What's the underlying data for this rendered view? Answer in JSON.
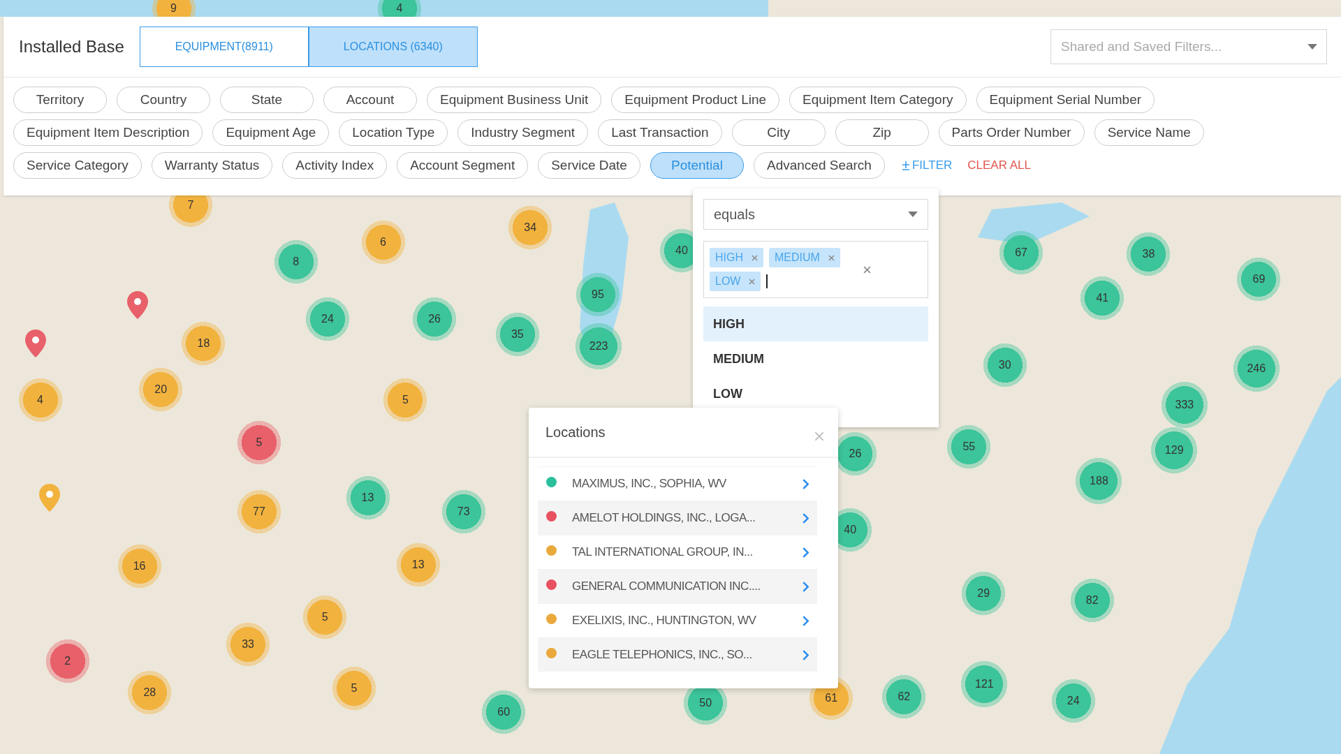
{
  "header": {
    "title": "Installed Base",
    "tabs": [
      {
        "label": "EQUIPMENT(8911)",
        "selected": false
      },
      {
        "label": "LOCATIONS (6340)",
        "selected": true
      }
    ],
    "saved_filters": {
      "placeholder": "Shared and Saved Filters..."
    }
  },
  "filters": [
    {
      "label": "Territory",
      "selected": false
    },
    {
      "label": "Country",
      "selected": false
    },
    {
      "label": "State",
      "selected": false
    },
    {
      "label": "Account",
      "selected": false
    },
    {
      "label": "Equipment Business Unit",
      "selected": false
    },
    {
      "label": "Equipment Product Line",
      "selected": false
    },
    {
      "label": "Equipment Item Category",
      "selected": false
    },
    {
      "label": "Equipment Serial Number",
      "selected": false
    },
    {
      "label": "Equipment Item Description",
      "selected": false
    },
    {
      "label": "Equipment Age",
      "selected": false
    },
    {
      "label": "Location Type",
      "selected": false
    },
    {
      "label": "Industry Segment",
      "selected": false
    },
    {
      "label": "Last Transaction",
      "selected": false
    },
    {
      "label": "City",
      "selected": false
    },
    {
      "label": "Zip",
      "selected": false
    },
    {
      "label": "Parts Order Number",
      "selected": false
    },
    {
      "label": "Service Name",
      "selected": false
    },
    {
      "label": "Service Category",
      "selected": false
    },
    {
      "label": "Warranty Status",
      "selected": false
    },
    {
      "label": "Activity Index",
      "selected": false
    },
    {
      "label": "Account Segment",
      "selected": false
    },
    {
      "label": "Service Date",
      "selected": false
    },
    {
      "label": "Potential",
      "selected": true
    },
    {
      "label": "Advanced Search",
      "selected": false
    }
  ],
  "add_filter": "FILTER",
  "clear_all": "CLEAR ALL",
  "filter_popover": {
    "operator": "equals",
    "tags": [
      "HIGH",
      "MEDIUM",
      "LOW"
    ],
    "options": [
      {
        "label": "HIGH",
        "selected": true
      },
      {
        "label": "MEDIUM",
        "selected": false
      },
      {
        "label": "LOW",
        "selected": false
      }
    ]
  },
  "map": {
    "clusters": [
      {
        "count": "9",
        "color": "#f2b23e"
      },
      {
        "count": "4",
        "color": "#3cc49a"
      },
      {
        "count": "7",
        "color": "#f2b23e"
      },
      {
        "count": "6",
        "color": "#f2b23e"
      },
      {
        "count": "34",
        "color": "#f2b23e"
      },
      {
        "count": "8",
        "color": "#3cc49a"
      },
      {
        "count": "40",
        "color": "#3cc49a"
      },
      {
        "count": "24",
        "color": "#3cc49a"
      },
      {
        "count": "26",
        "color": "#3cc49a"
      },
      {
        "count": "95",
        "color": "#3cc49a"
      },
      {
        "count": "35",
        "color": "#3cc49a"
      },
      {
        "count": "223",
        "color": "#3cc49a"
      },
      {
        "count": "18",
        "color": "#f2b23e"
      },
      {
        "count": "20",
        "color": "#f2b23e"
      },
      {
        "count": "4",
        "color": "#f2b23e"
      },
      {
        "count": "5",
        "color": "#f2b23e"
      },
      {
        "count": "5",
        "color": "#e8606a"
      },
      {
        "count": "13",
        "color": "#3cc49a"
      },
      {
        "count": "73",
        "color": "#3cc49a"
      },
      {
        "count": "77",
        "color": "#f2b23e"
      },
      {
        "count": "16",
        "color": "#f2b23e"
      },
      {
        "count": "13",
        "color": "#f2b23e"
      },
      {
        "count": "5",
        "color": "#f2b23e"
      },
      {
        "count": "33",
        "color": "#f2b23e"
      },
      {
        "count": "2",
        "color": "#e8606a"
      },
      {
        "count": "28",
        "color": "#f2b23e"
      },
      {
        "count": "5",
        "color": "#f2b23e"
      },
      {
        "count": "60",
        "color": "#3cc49a"
      },
      {
        "count": "50",
        "color": "#3cc49a"
      },
      {
        "count": "61",
        "color": "#f2b23e"
      },
      {
        "count": "62",
        "color": "#3cc49a"
      },
      {
        "count": "121",
        "color": "#3cc49a"
      },
      {
        "count": "24",
        "color": "#3cc49a"
      },
      {
        "count": "29",
        "color": "#3cc49a"
      },
      {
        "count": "82",
        "color": "#3cc49a"
      },
      {
        "count": "40",
        "color": "#3cc49a"
      },
      {
        "count": "26",
        "color": "#3cc49a"
      },
      {
        "count": "55",
        "color": "#3cc49a"
      },
      {
        "count": "188",
        "color": "#3cc49a"
      },
      {
        "count": "129",
        "color": "#3cc49a"
      },
      {
        "count": "333",
        "color": "#3cc49a"
      },
      {
        "count": "246",
        "color": "#3cc49a"
      },
      {
        "count": "30",
        "color": "#3cc49a"
      },
      {
        "count": "41",
        "color": "#3cc49a"
      },
      {
        "count": "67",
        "color": "#3cc49a"
      },
      {
        "count": "38",
        "color": "#3cc49a"
      },
      {
        "count": "69",
        "color": "#3cc49a"
      }
    ],
    "pins": [
      {
        "color": "#e8606a"
      },
      {
        "color": "#e8606a"
      },
      {
        "color": "#f2b23e"
      }
    ]
  },
  "locations_panel": {
    "title": "Locations",
    "items": [
      {
        "name": "MAXIMUS, INC., SOPHIA, WV",
        "color": "#2bbf9c"
      },
      {
        "name": "AMELOT HOLDINGS, INC., LOGA...",
        "color": "#e8505f"
      },
      {
        "name": "TAL INTERNATIONAL GROUP, IN...",
        "color": "#eaa93c"
      },
      {
        "name": "GENERAL COMMUNICATION INC....",
        "color": "#e8505f"
      },
      {
        "name": "EXELIXIS, INC., HUNTINGTON, WV",
        "color": "#eaa93c"
      },
      {
        "name": "EAGLE TELEPHONICS, INC., SO...",
        "color": "#eaa93c"
      }
    ]
  }
}
